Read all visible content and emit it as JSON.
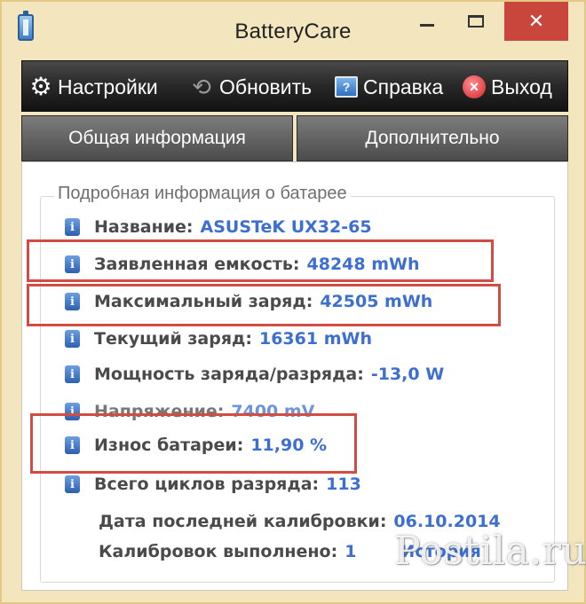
{
  "window": {
    "title": "BatteryCare",
    "close_glyph": "✕"
  },
  "toolbar": {
    "settings_label": "Настройки",
    "refresh_label": "Обновить",
    "help_label": "Справка",
    "exit_label": "Выход"
  },
  "tabs": {
    "general": "Общая информация",
    "advanced": "Дополнительно"
  },
  "battery_info": {
    "group_title": "Подробная информация о батарее",
    "rows": [
      {
        "label": "Название:",
        "value": "ASUSTeK UX32-65"
      },
      {
        "label": "Заявленная емкость:",
        "value": "48248 mWh"
      },
      {
        "label": "Максимальный заряд:",
        "value": "42505 mWh"
      },
      {
        "label": "Текущий заряд:",
        "value": "16361 mWh"
      },
      {
        "label": "Мощность заряда/разряда:",
        "value": "-13,0 W"
      },
      {
        "label": "Напряжение:",
        "value": "7400 mV"
      },
      {
        "label": "Износ батареи:",
        "value": "11,90 %"
      },
      {
        "label": "Всего циклов разряда:",
        "value": "113"
      },
      {
        "label": "Дата последней калибровки:",
        "value": "06.10.2014"
      },
      {
        "label": "Калибровок выполнено:",
        "value": "1"
      }
    ],
    "history_link": "История"
  },
  "watermark": "Postila.ru",
  "colors": {
    "window_frame": "#f3e6bf",
    "highlight_box": "#d34c43",
    "value_text": "#3d6fd1",
    "close_button": "#c9463d"
  },
  "icons": [
    "app-battery-icon",
    "gear-icon",
    "refresh-icon",
    "help-book-icon",
    "exit-x-icon",
    "info-icon"
  ]
}
